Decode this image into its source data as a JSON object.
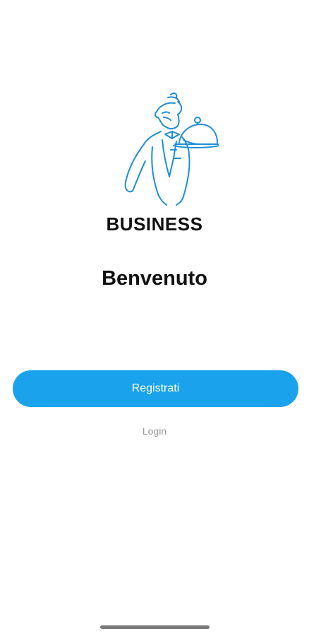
{
  "logo": {
    "icon": "waiter-with-cloche-icon",
    "color": "#1f8fd6"
  },
  "brand": {
    "title": "BUSINESS"
  },
  "welcome": {
    "title": "Benvenuto"
  },
  "actions": {
    "register_label": "Registrati",
    "login_label": "Login",
    "accent_color": "#1aa3ec"
  }
}
